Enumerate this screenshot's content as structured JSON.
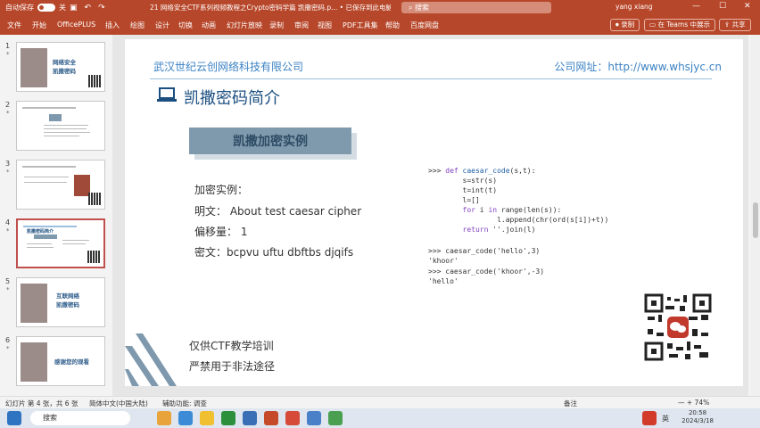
{
  "titlebar": {
    "autosave_label": "自动保存",
    "toggle_state": "关",
    "doc_title": "21 网络安全CTF系列视频教程之Crypto密码学篇 凯撒密码.p...",
    "saved_status": "已保存到此电脑",
    "search_placeholder": "搜索",
    "user": "yang xiang",
    "minimize": "—",
    "maximize": "☐",
    "close": "✕"
  },
  "ribbon": {
    "tabs": [
      "文件",
      "开始",
      "OfficePLUS",
      "插入",
      "绘图",
      "设计",
      "切换",
      "动画",
      "幻灯片放映",
      "录制",
      "审阅",
      "视图",
      "PDF工具集",
      "帮助",
      "百度网盘"
    ],
    "record_label": "录制",
    "teams_label": "在 Teams 中展示",
    "share_label": "共享"
  },
  "thumbnails": [
    {
      "num": "1",
      "star": "*",
      "text": "网络安全\n凯撒密码"
    },
    {
      "num": "2",
      "star": "*",
      "text": ""
    },
    {
      "num": "3",
      "star": "*",
      "text": ""
    },
    {
      "num": "4",
      "star": "*",
      "text": "凯撒密码简介"
    },
    {
      "num": "5",
      "star": "*",
      "text": "互联网络\n凯撒密码"
    },
    {
      "num": "6",
      "star": "*",
      "text": "感谢您的观看"
    }
  ],
  "slide": {
    "company": "武汉世纪云创网络科技有限公司",
    "website": "公司网址：http://www.whsjyc.cn",
    "title": "凯撒密码简介",
    "banner": "凯撒加密实例",
    "example_heading": "加密实例：",
    "plaintext": "明文：  About test caesar cipher",
    "offset": "偏移量：  1",
    "ciphertext": "密文：bcpvu uftu dbftbs djqifs",
    "code": {
      "l1_prompt": ">>> ",
      "l1_kw": "def ",
      "l1_fn": "caesar_code",
      "l1_rest": "(s,t):",
      "l2": "        s=str(s)",
      "l3": "        t=int(t)",
      "l4": "        l=[]",
      "l5_kw1": "        for ",
      "l5_a": "i ",
      "l5_kw2": "in ",
      "l5_b": "range(len(s)):",
      "l6": "                l.append(chr(ord(s[i])+t))",
      "l7_kw": "        return ",
      "l7_rest": "''.join(l)",
      "l8": ">>> caesar_code('hello',3)",
      "l9": "'khoor'",
      "l10": ">>> caesar_code('khoor',-3)",
      "l11": "'hello'"
    },
    "footer1": "仅供CTF教学培训",
    "footer2": "严禁用于非法途径"
  },
  "statusbar": {
    "slide_info": "幻灯片 第 4 张，共 6 张",
    "language": "简体中文(中国大陆)",
    "accessibility": "辅助功能: 调查",
    "notes": "备注",
    "zoom": "—   +   74%"
  },
  "taskbar": {
    "search_placeholder": "搜索",
    "time": "20:58",
    "date": "2024/3/18",
    "lang": "英"
  },
  "colors": {
    "accent": "#b7472a",
    "company_blue": "#3b82c4",
    "title_blue": "#1c4f80",
    "banner": "#7f99ad"
  }
}
